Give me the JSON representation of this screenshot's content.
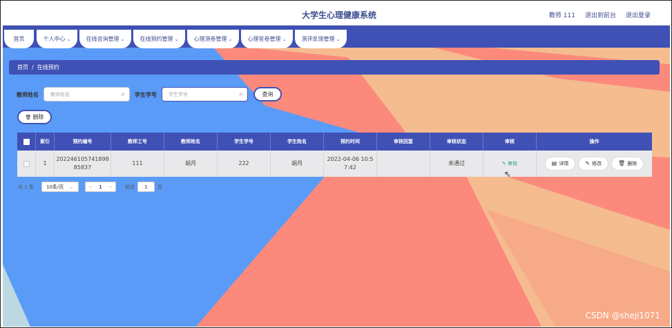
{
  "header": {
    "title": "大学生心理健康系统",
    "user": "教师 111",
    "back_label": "退出到前台",
    "logout_label": "退出登录"
  },
  "nav": {
    "items": [
      {
        "label": "首页",
        "has_dropdown": false
      },
      {
        "label": "个人中心",
        "has_dropdown": true
      },
      {
        "label": "在线咨询管理",
        "has_dropdown": true
      },
      {
        "label": "在线预约管理",
        "has_dropdown": true
      },
      {
        "label": "心理测卷管理",
        "has_dropdown": true
      },
      {
        "label": "心理答卷管理",
        "has_dropdown": true
      },
      {
        "label": "测评反馈管理",
        "has_dropdown": true
      }
    ],
    "chevron": "⌄"
  },
  "breadcrumb": {
    "home": "首页",
    "separator": "/",
    "current": "在线预约"
  },
  "search": {
    "teacher_label": "教师姓名",
    "teacher_placeholder": "教师姓名",
    "student_label": "学生学号",
    "student_placeholder": "学生学号",
    "query_label": "查询",
    "search_icon": "⌕"
  },
  "toolbar": {
    "delete_label": "删除",
    "delete_icon": "🗑"
  },
  "table": {
    "headers": [
      "索引",
      "预约编号",
      "教师工号",
      "教师姓名",
      "学生学号",
      "学生姓名",
      "预约时间",
      "审核回复",
      "审核状态",
      "审核",
      "操作"
    ],
    "rows": [
      {
        "index": "1",
        "booking_no_1": "202246105741898",
        "booking_no_2": "85837",
        "teacher_id": "111",
        "teacher_name": "胡月",
        "student_id": "222",
        "student_name": "胡月",
        "time_1": "2022-04-06 10:5",
        "time_2": "7:42",
        "reply": "",
        "status": "未通过",
        "audit_label": "审核",
        "detail_label": "详情",
        "edit_label": "修改",
        "delete_label": "删除"
      }
    ]
  },
  "pagination": {
    "total": "共 1 条",
    "page_size": "10条/页",
    "prev": "‹",
    "current_page": "1",
    "next": "›",
    "goto_label": "前往",
    "goto_value": "1",
    "page_unit": "页"
  },
  "watermark": "CSDN @sheji1071",
  "colors": {
    "primary": "#3f51b5",
    "bg_blue": "#5b9bf8",
    "bg_peach": "#f5bc90",
    "bg_coral": "#fb8a7c",
    "bg_lightblue": "#bcd9e2",
    "audit_green": "#2a9d8f"
  }
}
